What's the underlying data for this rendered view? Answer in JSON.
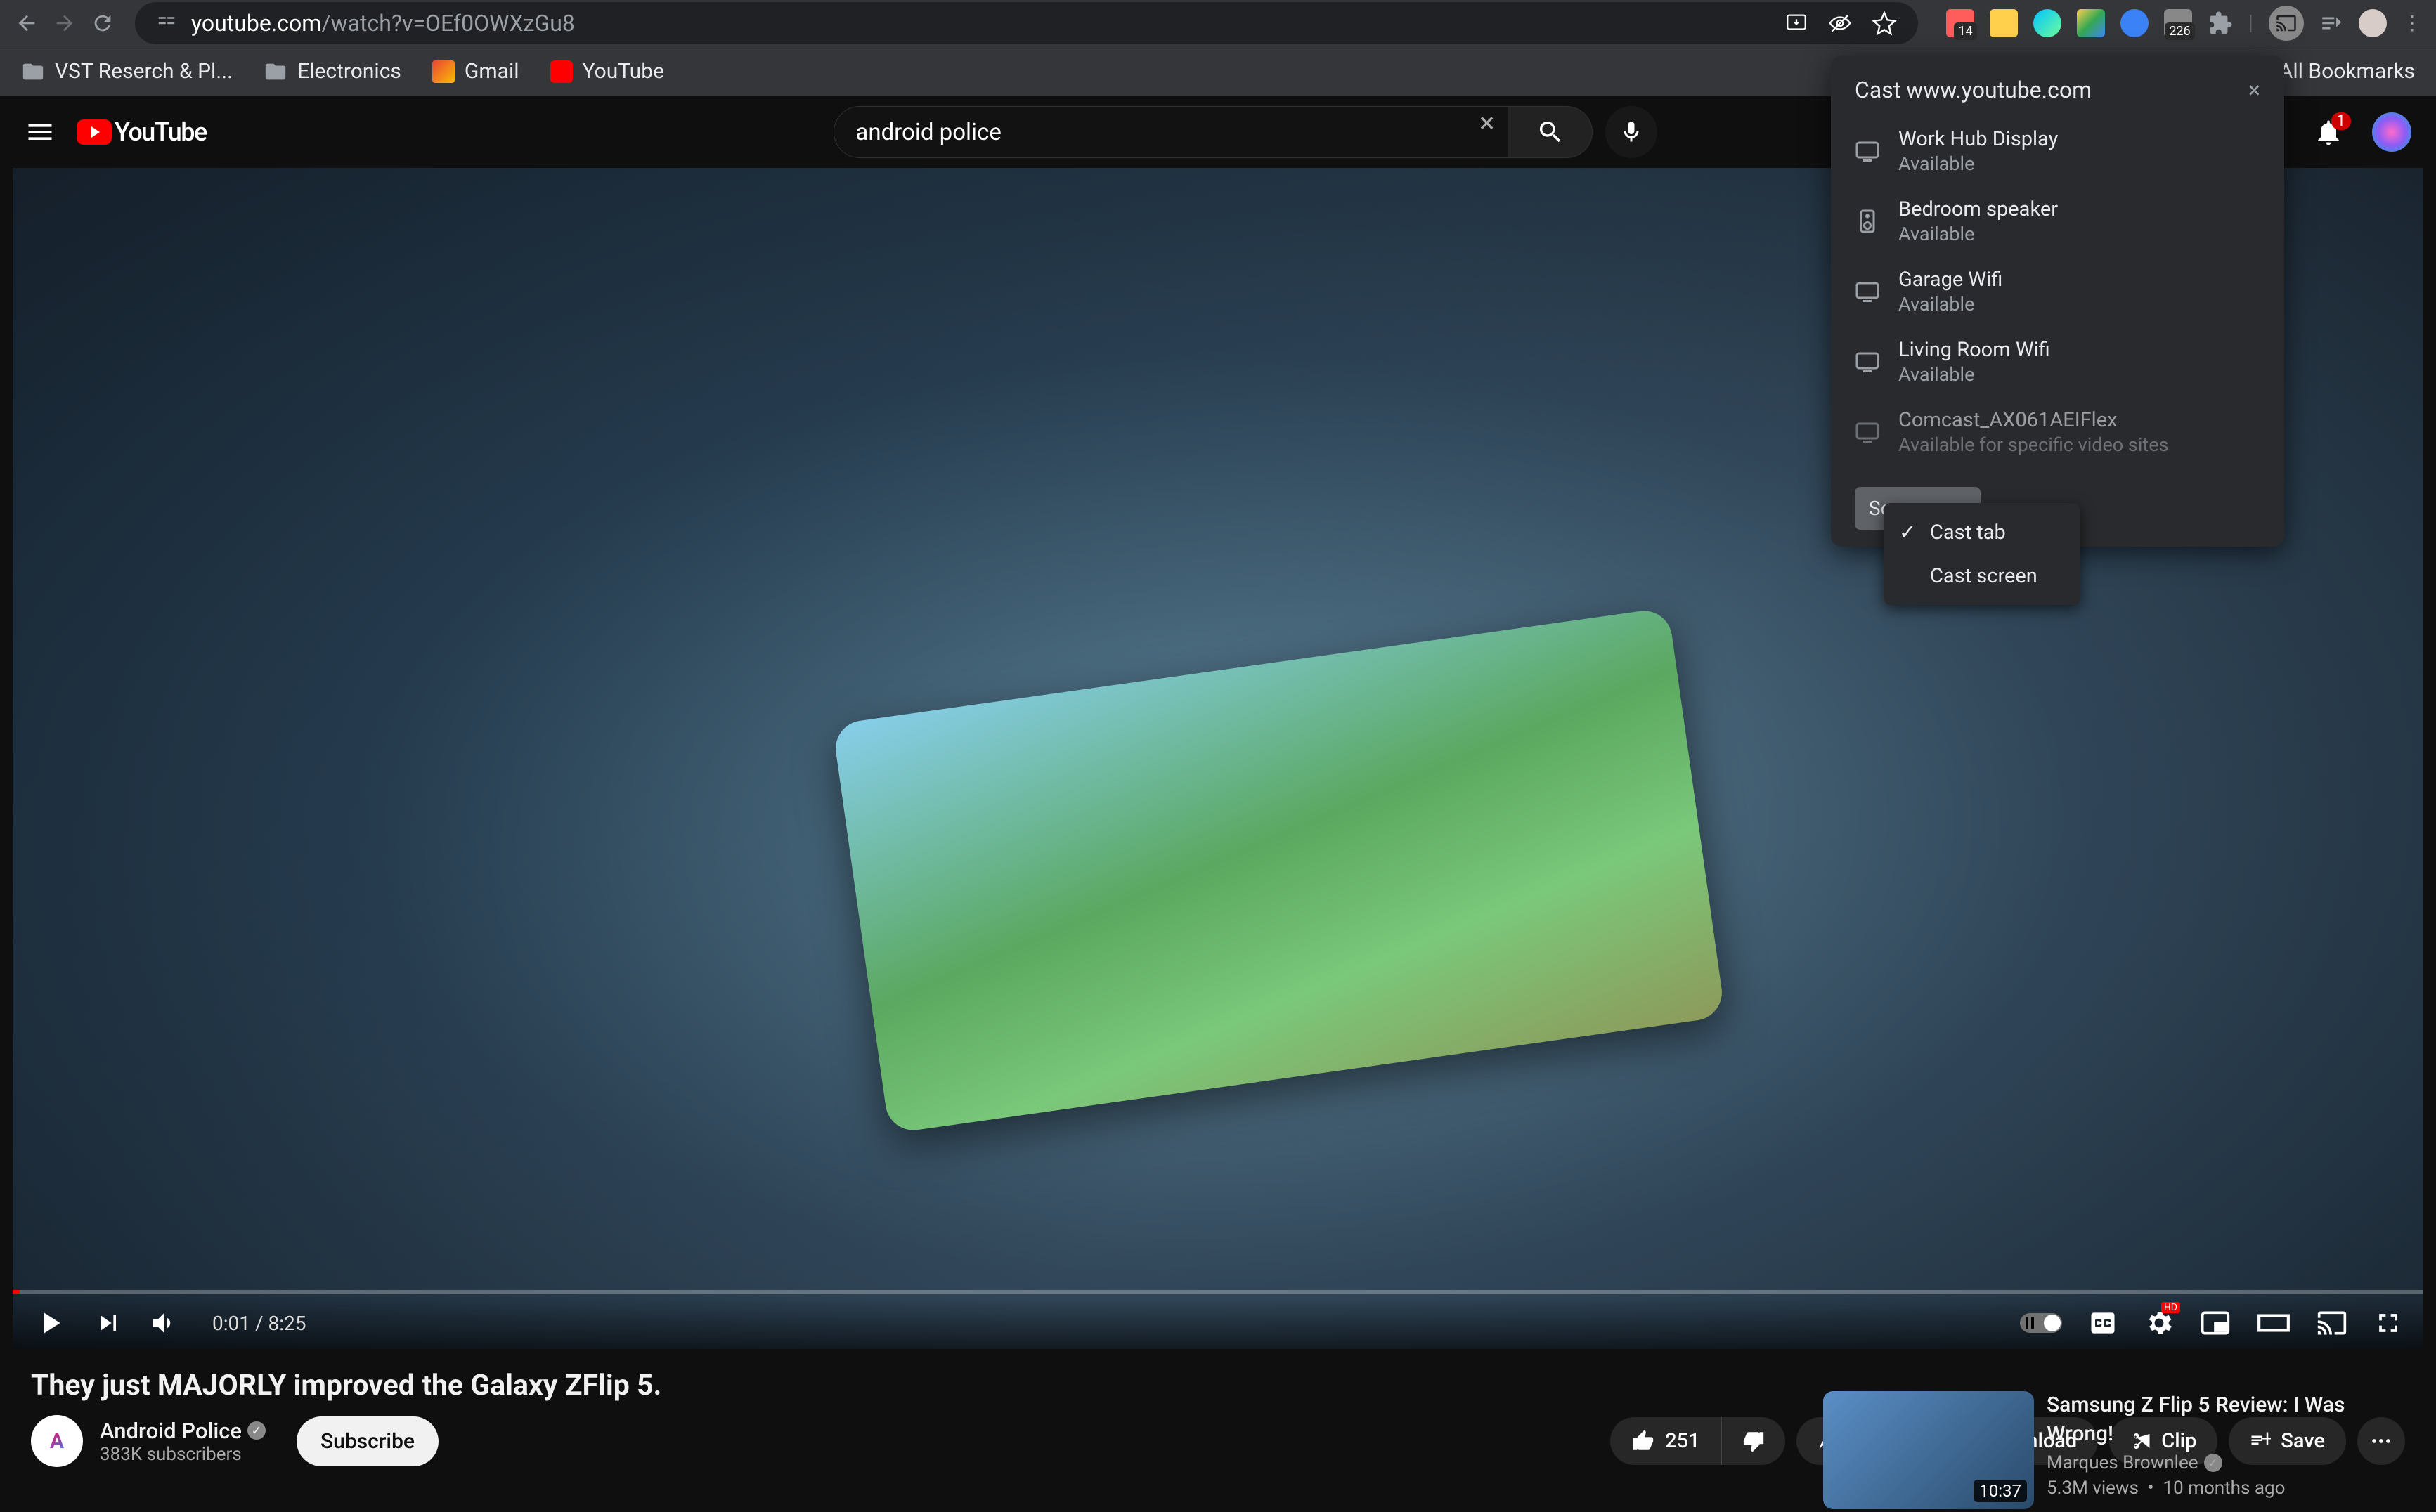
{
  "browser": {
    "url_domain": "youtube.com",
    "url_path": "/watch?v=OEf0OWXzGu8",
    "bookmarks": [
      {
        "label": "VST Reserch & Pl...",
        "type": "folder"
      },
      {
        "label": "Electronics",
        "type": "folder"
      },
      {
        "label": "Gmail",
        "type": "gmail"
      },
      {
        "label": "YouTube",
        "type": "youtube"
      }
    ],
    "all_bookmarks": "All Bookmarks",
    "ext_badges": {
      "cal": "14",
      "n226": "226"
    }
  },
  "yt": {
    "search_value": "android police",
    "search_placeholder": "Search",
    "notif_count": "1"
  },
  "player": {
    "current_time": "0:01",
    "duration": "8:25"
  },
  "video": {
    "title": "They just MAJORLY improved the Galaxy ZFlip 5.",
    "channel": "Android Police",
    "subscribers": "383K subscribers",
    "subscribe": "Subscribe",
    "likes": "251",
    "share": "Share",
    "download": "Download",
    "clip": "Clip",
    "save": "Save"
  },
  "recommended": {
    "title": "Samsung Z Flip 5 Review: I Was Wrong!",
    "channel": "Marques Brownlee",
    "views": "5.3M views",
    "age": "10 months ago",
    "duration": "10:37"
  },
  "cast": {
    "title": "Cast www.youtube.com",
    "devices": [
      {
        "name": "Work Hub Display",
        "status": "Available",
        "type": "display"
      },
      {
        "name": "Bedroom speaker",
        "status": "Available",
        "type": "speaker"
      },
      {
        "name": "Garage Wifi",
        "status": "Available",
        "type": "display"
      },
      {
        "name": "Living Room Wifi",
        "status": "Available",
        "type": "display"
      },
      {
        "name": "Comcast_AX061AEIFlex",
        "status": "Available for specific video sites",
        "type": "tv",
        "disabled": true
      }
    ],
    "sources_label": "Sources",
    "source_options": [
      {
        "label": "Cast tab",
        "checked": true
      },
      {
        "label": "Cast screen",
        "checked": false
      }
    ]
  }
}
